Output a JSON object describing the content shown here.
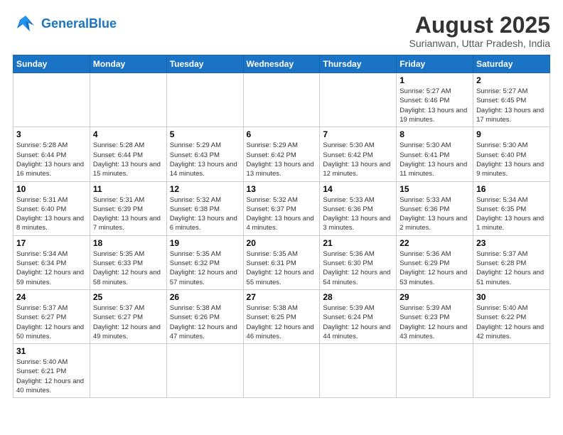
{
  "header": {
    "logo_general": "General",
    "logo_blue": "Blue",
    "title": "August 2025",
    "subtitle": "Surianwan, Uttar Pradesh, India"
  },
  "days_of_week": [
    "Sunday",
    "Monday",
    "Tuesday",
    "Wednesday",
    "Thursday",
    "Friday",
    "Saturday"
  ],
  "weeks": [
    [
      {
        "day": "",
        "info": ""
      },
      {
        "day": "",
        "info": ""
      },
      {
        "day": "",
        "info": ""
      },
      {
        "day": "",
        "info": ""
      },
      {
        "day": "",
        "info": ""
      },
      {
        "day": "1",
        "info": "Sunrise: 5:27 AM\nSunset: 6:46 PM\nDaylight: 13 hours and 19 minutes."
      },
      {
        "day": "2",
        "info": "Sunrise: 5:27 AM\nSunset: 6:45 PM\nDaylight: 13 hours and 17 minutes."
      }
    ],
    [
      {
        "day": "3",
        "info": "Sunrise: 5:28 AM\nSunset: 6:44 PM\nDaylight: 13 hours and 16 minutes."
      },
      {
        "day": "4",
        "info": "Sunrise: 5:28 AM\nSunset: 6:44 PM\nDaylight: 13 hours and 15 minutes."
      },
      {
        "day": "5",
        "info": "Sunrise: 5:29 AM\nSunset: 6:43 PM\nDaylight: 13 hours and 14 minutes."
      },
      {
        "day": "6",
        "info": "Sunrise: 5:29 AM\nSunset: 6:42 PM\nDaylight: 13 hours and 13 minutes."
      },
      {
        "day": "7",
        "info": "Sunrise: 5:30 AM\nSunset: 6:42 PM\nDaylight: 13 hours and 12 minutes."
      },
      {
        "day": "8",
        "info": "Sunrise: 5:30 AM\nSunset: 6:41 PM\nDaylight: 13 hours and 11 minutes."
      },
      {
        "day": "9",
        "info": "Sunrise: 5:30 AM\nSunset: 6:40 PM\nDaylight: 13 hours and 9 minutes."
      }
    ],
    [
      {
        "day": "10",
        "info": "Sunrise: 5:31 AM\nSunset: 6:40 PM\nDaylight: 13 hours and 8 minutes."
      },
      {
        "day": "11",
        "info": "Sunrise: 5:31 AM\nSunset: 6:39 PM\nDaylight: 13 hours and 7 minutes."
      },
      {
        "day": "12",
        "info": "Sunrise: 5:32 AM\nSunset: 6:38 PM\nDaylight: 13 hours and 6 minutes."
      },
      {
        "day": "13",
        "info": "Sunrise: 5:32 AM\nSunset: 6:37 PM\nDaylight: 13 hours and 4 minutes."
      },
      {
        "day": "14",
        "info": "Sunrise: 5:33 AM\nSunset: 6:36 PM\nDaylight: 13 hours and 3 minutes."
      },
      {
        "day": "15",
        "info": "Sunrise: 5:33 AM\nSunset: 6:36 PM\nDaylight: 13 hours and 2 minutes."
      },
      {
        "day": "16",
        "info": "Sunrise: 5:34 AM\nSunset: 6:35 PM\nDaylight: 13 hours and 1 minute."
      }
    ],
    [
      {
        "day": "17",
        "info": "Sunrise: 5:34 AM\nSunset: 6:34 PM\nDaylight: 12 hours and 59 minutes."
      },
      {
        "day": "18",
        "info": "Sunrise: 5:35 AM\nSunset: 6:33 PM\nDaylight: 12 hours and 58 minutes."
      },
      {
        "day": "19",
        "info": "Sunrise: 5:35 AM\nSunset: 6:32 PM\nDaylight: 12 hours and 57 minutes."
      },
      {
        "day": "20",
        "info": "Sunrise: 5:35 AM\nSunset: 6:31 PM\nDaylight: 12 hours and 55 minutes."
      },
      {
        "day": "21",
        "info": "Sunrise: 5:36 AM\nSunset: 6:30 PM\nDaylight: 12 hours and 54 minutes."
      },
      {
        "day": "22",
        "info": "Sunrise: 5:36 AM\nSunset: 6:29 PM\nDaylight: 12 hours and 53 minutes."
      },
      {
        "day": "23",
        "info": "Sunrise: 5:37 AM\nSunset: 6:28 PM\nDaylight: 12 hours and 51 minutes."
      }
    ],
    [
      {
        "day": "24",
        "info": "Sunrise: 5:37 AM\nSunset: 6:27 PM\nDaylight: 12 hours and 50 minutes."
      },
      {
        "day": "25",
        "info": "Sunrise: 5:37 AM\nSunset: 6:27 PM\nDaylight: 12 hours and 49 minutes."
      },
      {
        "day": "26",
        "info": "Sunrise: 5:38 AM\nSunset: 6:26 PM\nDaylight: 12 hours and 47 minutes."
      },
      {
        "day": "27",
        "info": "Sunrise: 5:38 AM\nSunset: 6:25 PM\nDaylight: 12 hours and 46 minutes."
      },
      {
        "day": "28",
        "info": "Sunrise: 5:39 AM\nSunset: 6:24 PM\nDaylight: 12 hours and 44 minutes."
      },
      {
        "day": "29",
        "info": "Sunrise: 5:39 AM\nSunset: 6:23 PM\nDaylight: 12 hours and 43 minutes."
      },
      {
        "day": "30",
        "info": "Sunrise: 5:40 AM\nSunset: 6:22 PM\nDaylight: 12 hours and 42 minutes."
      }
    ],
    [
      {
        "day": "31",
        "info": "Sunrise: 5:40 AM\nSunset: 6:21 PM\nDaylight: 12 hours and 40 minutes."
      },
      {
        "day": "",
        "info": ""
      },
      {
        "day": "",
        "info": ""
      },
      {
        "day": "",
        "info": ""
      },
      {
        "day": "",
        "info": ""
      },
      {
        "day": "",
        "info": ""
      },
      {
        "day": "",
        "info": ""
      }
    ]
  ]
}
